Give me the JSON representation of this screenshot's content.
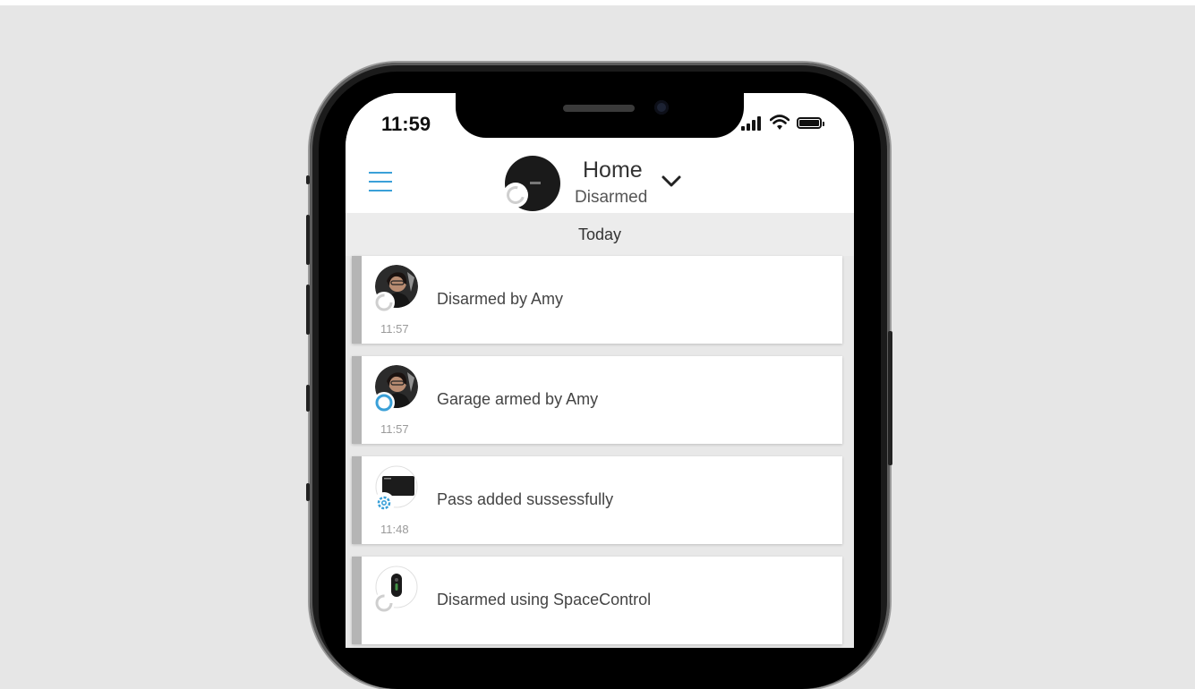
{
  "status_bar": {
    "time": "11:59"
  },
  "header": {
    "hub_name": "Home",
    "hub_status": "Disarmed",
    "menu_icon": "hamburger-icon",
    "dropdown_icon": "chevron-down-icon"
  },
  "feed": {
    "section_title": "Today",
    "events": [
      {
        "text": "Disarmed by Amy",
        "time": "11:57",
        "avatar": "user-avatar",
        "badge": "disarmed-ring-icon"
      },
      {
        "text": "Garage armed by Amy",
        "time": "11:57",
        "avatar": "user-avatar",
        "badge": "armed-ring-icon"
      },
      {
        "text": "Pass added sussessfully",
        "time": "11:48",
        "avatar": "pass-card-avatar",
        "badge": "gear-icon"
      },
      {
        "text": "Disarmed using SpaceControl",
        "time": "",
        "avatar": "keyfob-avatar",
        "badge": "disarmed-ring-icon"
      }
    ]
  },
  "colors": {
    "accent": "#3aa0d8",
    "page_background": "#e6e6e6",
    "card_stripe": "#b5b5b5"
  }
}
